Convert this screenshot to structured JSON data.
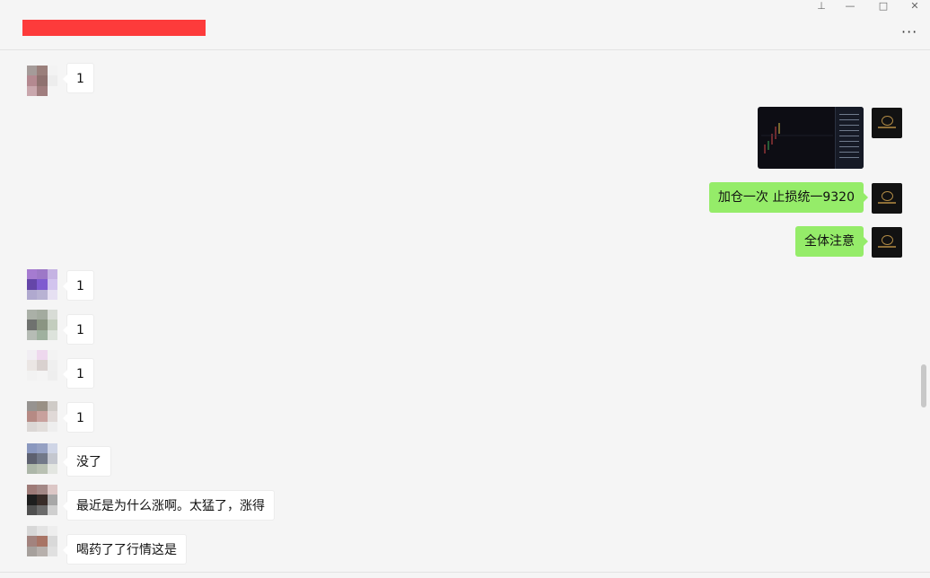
{
  "window": {
    "title": "",
    "buttons": {
      "pin": "⊥",
      "minimize": "—",
      "maximize": "□",
      "close": "✕"
    },
    "more_icon": "···"
  },
  "messages": [
    {
      "side": "in",
      "text": "1"
    },
    {
      "side": "out",
      "type": "image",
      "description_icon": "chart-image"
    },
    {
      "side": "out",
      "text": "加仓一次 止损统一9320"
    },
    {
      "side": "out",
      "text": "全体注意"
    },
    {
      "side": "in",
      "text": "1"
    },
    {
      "side": "in",
      "text": "1"
    },
    {
      "side": "in",
      "text": "1"
    },
    {
      "side": "in",
      "text": "1"
    },
    {
      "side": "in",
      "text": "没了"
    },
    {
      "side": "in",
      "text": "最近是为什么涨啊。太猛了，涨得"
    },
    {
      "side": "in",
      "text": "喝药了了行情这是"
    }
  ],
  "colors": {
    "outgoing_bubble": "#95ec69",
    "incoming_bubble": "#ffffff",
    "title_redaction": "#fd3b3b",
    "background": "#f5f5f5"
  }
}
